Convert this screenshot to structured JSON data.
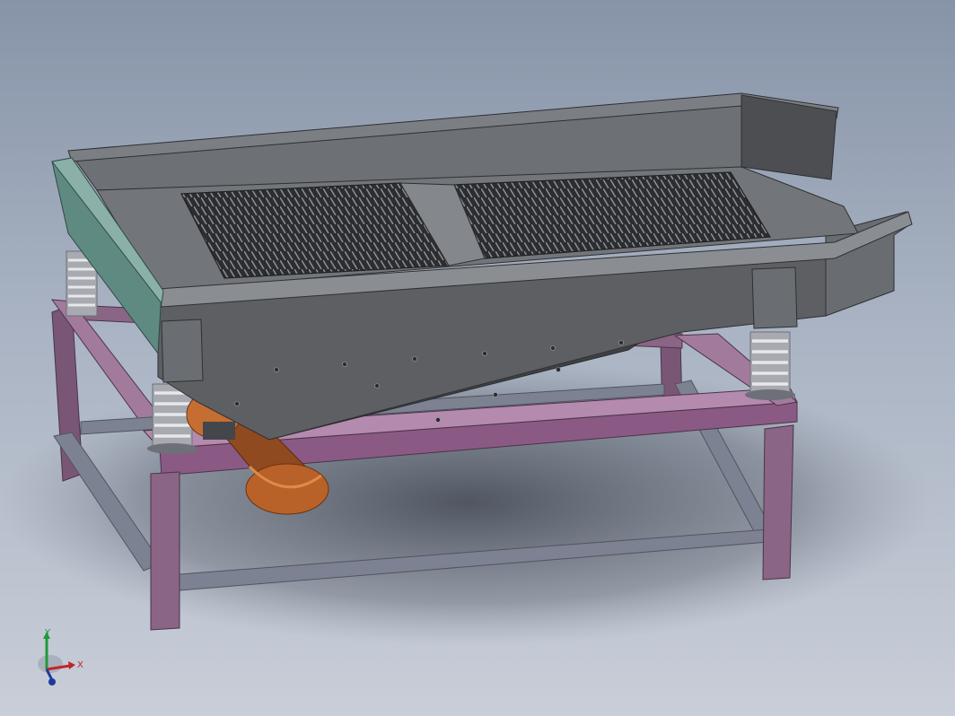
{
  "viewport": {
    "background_top": "#8794a8",
    "background_bottom": "#c9ced8"
  },
  "model": {
    "frame_color": "#7a5676",
    "frame_highlight": "#a27b9c",
    "body_color": "#5d5f63",
    "body_dark": "#46484b",
    "body_light": "#76797e",
    "screen_color": "#2e3033",
    "end_plate_color": "#5f8a82",
    "motor_color": "#b8622a",
    "spring_color": "#c9c9cb"
  },
  "triad": {
    "x_label": "X",
    "y_label": "Y",
    "x_color": "#c0262a",
    "y_color": "#1f9a3a",
    "z_color": "#1d3a9a"
  }
}
